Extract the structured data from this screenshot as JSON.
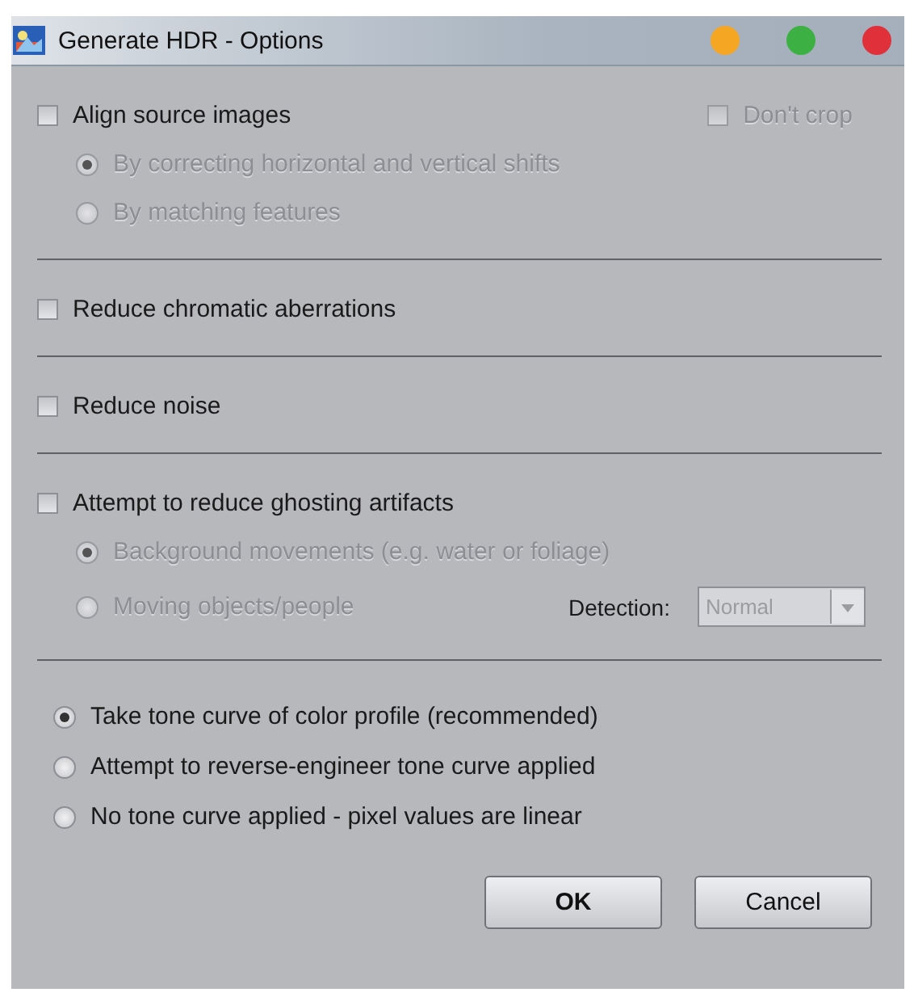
{
  "window": {
    "title": "Generate HDR - Options",
    "controls": [
      {
        "color": "#f5a623"
      },
      {
        "color": "#3cb043"
      },
      {
        "color": "#e0313a"
      }
    ]
  },
  "sections": [
    {
      "kind": "check",
      "option": {
        "label": "Align source images",
        "checked": false,
        "disabled": false
      },
      "side_option": {
        "label": "Don't crop",
        "checked": false,
        "disabled": true
      },
      "choices": [
        {
          "label": "By correcting horizontal and vertical shifts",
          "selected": true,
          "disabled": true
        },
        {
          "label": "By matching features",
          "selected": false,
          "disabled": true
        }
      ]
    },
    {
      "kind": "check",
      "option": {
        "label": "Reduce chromatic aberrations",
        "checked": false,
        "disabled": false
      }
    },
    {
      "kind": "check",
      "option": {
        "label": "Reduce noise",
        "checked": false,
        "disabled": false
      }
    },
    {
      "kind": "check",
      "option": {
        "label": "Attempt to reduce ghosting artifacts",
        "checked": false,
        "disabled": false
      },
      "choices": [
        {
          "label": "Background movements (e.g. water or foliage)",
          "selected": true,
          "disabled": true
        },
        {
          "label": "Moving objects/people",
          "selected": false,
          "disabled": true
        }
      ],
      "detection": {
        "label": "Detection:",
        "value": "Normal",
        "disabled": true
      }
    },
    {
      "kind": "radios",
      "choices": [
        {
          "label": "Take tone curve of color profile (recommended)",
          "selected": true,
          "disabled": false
        },
        {
          "label": "Attempt to reverse-engineer tone curve applied",
          "selected": false,
          "disabled": false
        },
        {
          "label": "No tone curve applied - pixel values are linear",
          "selected": false,
          "disabled": false
        }
      ]
    }
  ],
  "buttons": [
    {
      "label": "OK",
      "default": true
    },
    {
      "label": "Cancel",
      "default": false
    }
  ]
}
